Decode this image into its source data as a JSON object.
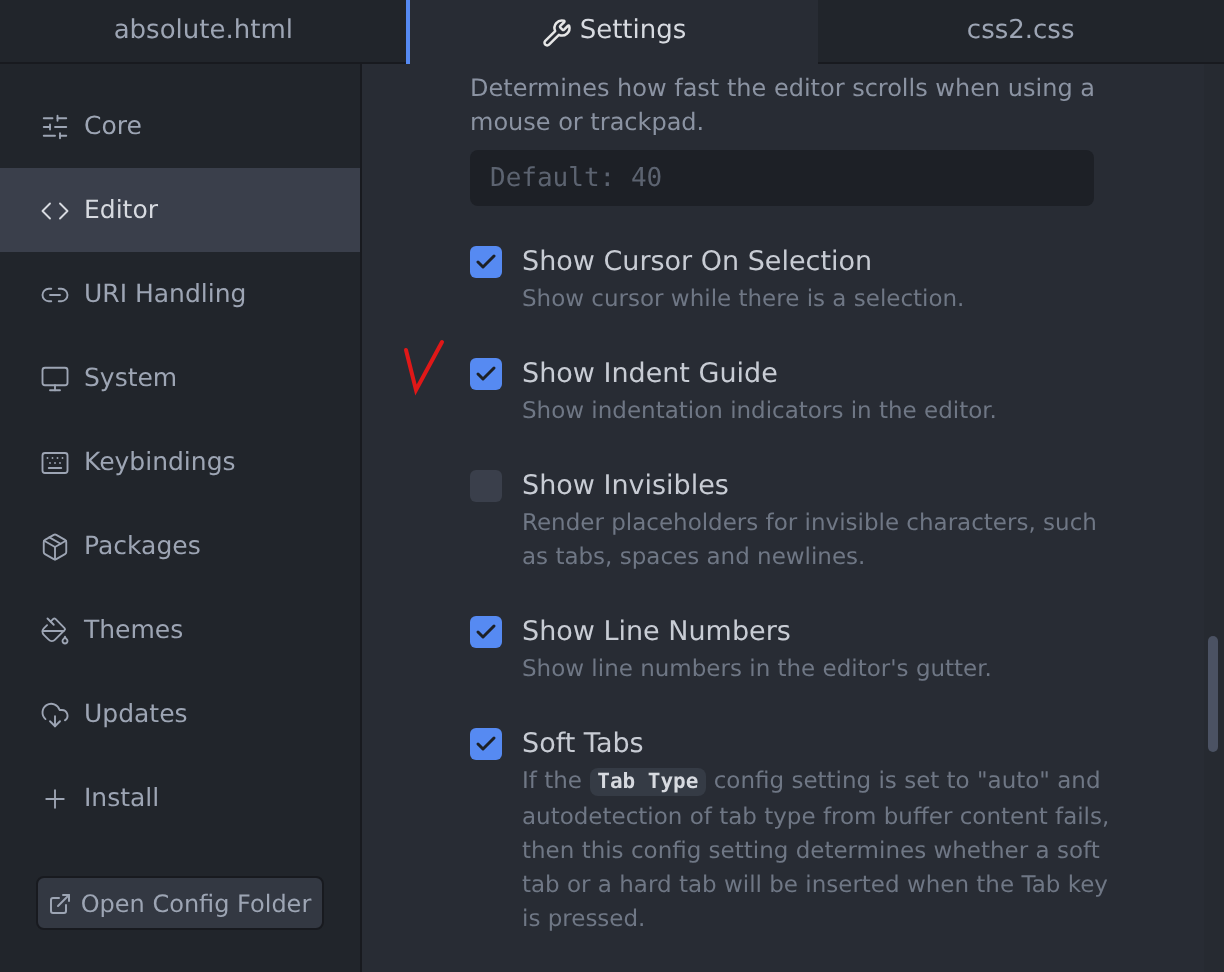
{
  "tabs": [
    {
      "label": "absolute.html",
      "selected": false
    },
    {
      "label": "Settings",
      "selected": true
    },
    {
      "label": "css2.css",
      "selected": false
    }
  ],
  "sidebar": {
    "items": [
      {
        "label": "Core",
        "selected": false
      },
      {
        "label": "Editor",
        "selected": true
      },
      {
        "label": "URI Handling",
        "selected": false
      },
      {
        "label": "System",
        "selected": false
      },
      {
        "label": "Keybindings",
        "selected": false
      },
      {
        "label": "Packages",
        "selected": false
      },
      {
        "label": "Themes",
        "selected": false
      },
      {
        "label": "Updates",
        "selected": false
      },
      {
        "label": "Install",
        "selected": false
      }
    ],
    "button": "Open Config Folder"
  },
  "scroll_setting": {
    "description": "Determines how fast the editor scrolls when using a mouse or trackpad.",
    "placeholder": "Default: 40"
  },
  "settings": [
    {
      "title": "Show Cursor On Selection",
      "checked": true,
      "description": "Show cursor while there is a selection."
    },
    {
      "title": "Show Indent Guide",
      "checked": true,
      "description": "Show indentation indicators in the editor."
    },
    {
      "title": "Show Invisibles",
      "checked": false,
      "description": "Render placeholders for invisible characters, such as tabs, spaces and newlines."
    },
    {
      "title": "Show Line Numbers",
      "checked": true,
      "description": "Show line numbers in the editor's gutter."
    },
    {
      "title": "Soft Tabs",
      "checked": true,
      "description": "If the",
      "code": "Tab Type",
      "description_after": "config setting is set to \"auto\" and autodetection of tab type from buffer content fails, then this config setting determines whether a soft tab or a hard tab will be inserted when the Tab key is pressed."
    }
  ]
}
